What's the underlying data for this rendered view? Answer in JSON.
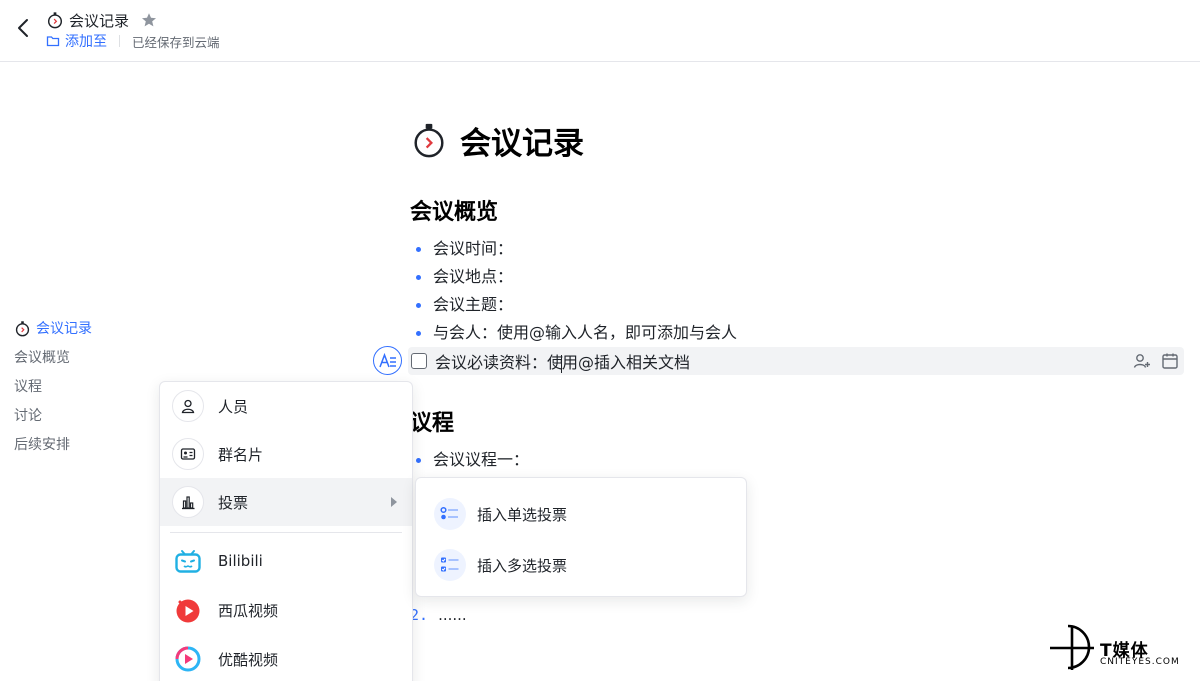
{
  "header": {
    "title": "会议记录",
    "add_to_label": "添加至",
    "save_status": "已经保存到云端"
  },
  "outline": {
    "items": [
      {
        "label": "会议记录",
        "active": true
      },
      {
        "label": "会议概览",
        "active": false
      },
      {
        "label": "议程",
        "active": false
      },
      {
        "label": "讨论",
        "active": false
      },
      {
        "label": "后续安排",
        "active": false
      }
    ]
  },
  "document": {
    "title": "会议记录",
    "sections": [
      {
        "heading": "会议概览",
        "bullets": [
          "会议时间：",
          "会议地点：",
          "会议主题：",
          "与会人：使用@输入人名，即可添加与会人"
        ],
        "todo": {
          "text_before": "会议必读资料：使",
          "text_after": "用@插入相关文档",
          "checked": false
        }
      },
      {
        "heading": "议程",
        "bullets": [
          "会议议程一："
        ]
      }
    ],
    "numbered_list": {
      "last_number": "2.",
      "last_text": "......"
    }
  },
  "insert_menu": {
    "items": [
      {
        "label": "人员",
        "icon": "person-icon"
      },
      {
        "label": "群名片",
        "icon": "group-card-icon"
      },
      {
        "label": "投票",
        "icon": "vote-chart-icon",
        "has_submenu": true,
        "hovered": true
      },
      {
        "label": "Bilibili",
        "icon": "bilibili-icon"
      },
      {
        "label": "西瓜视频",
        "icon": "xigua-video-icon"
      },
      {
        "label": "优酷视频",
        "icon": "youku-icon"
      }
    ]
  },
  "vote_submenu": {
    "items": [
      {
        "label": "插入单选投票",
        "icon": "single-choice-vote-icon"
      },
      {
        "label": "插入多选投票",
        "icon": "multi-choice-vote-icon"
      }
    ]
  },
  "watermark": {
    "brand": "T媒体",
    "url": "CNITEYES.COM"
  },
  "colors": {
    "accent": "#3370ff",
    "text": "#1f2329",
    "muted": "#646a73",
    "hover_bg": "#f2f3f5"
  }
}
